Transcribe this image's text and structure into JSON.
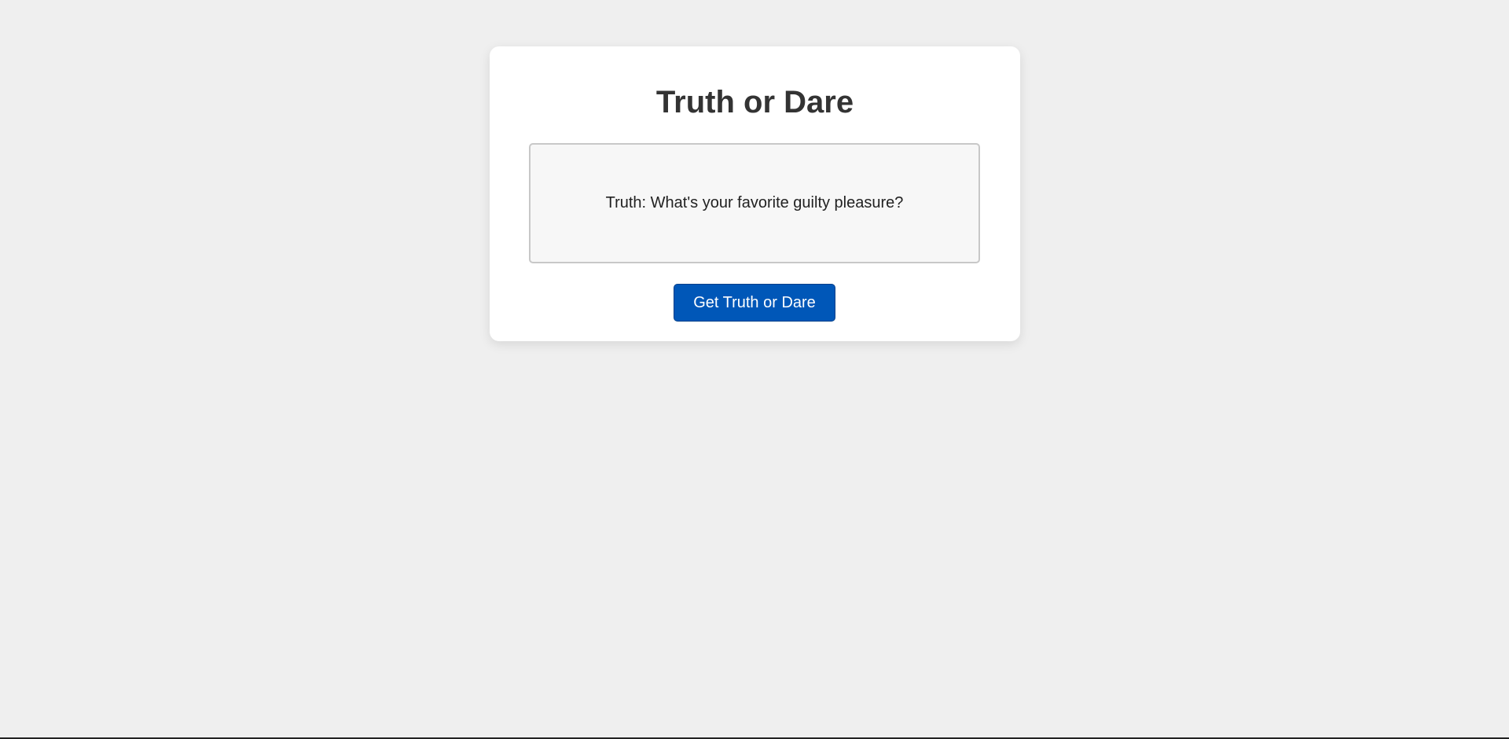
{
  "card": {
    "title": "Truth or Dare",
    "prompt_text": "Truth: What's your favorite guilty pleasure?",
    "button_label": "Get Truth or Dare"
  },
  "colors": {
    "background": "#efefef",
    "card": "#ffffff",
    "title_text": "#333333",
    "prompt_box_bg": "#f7f7f7",
    "prompt_box_border": "#c8c8c8",
    "button_bg": "#0057b8",
    "button_text": "#ffffff"
  }
}
